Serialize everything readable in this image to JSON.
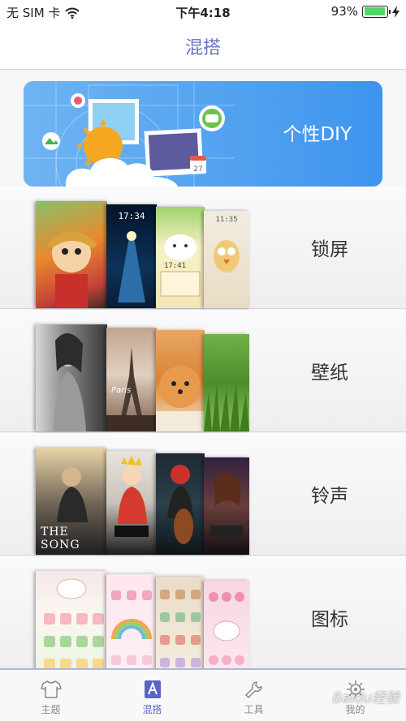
{
  "status": {
    "carrier": "无 SIM 卡",
    "time": "下午4:18",
    "battery_percent": "93%",
    "battery_level": 0.93,
    "wifi_icon": "wifi-icon",
    "charging_icon": "bolt-icon"
  },
  "nav": {
    "title": "混搭"
  },
  "banner": {
    "label": "个性DIY",
    "calendar_day": "27"
  },
  "rows": [
    {
      "label": "锁屏",
      "lock_time": "17:34",
      "lock_time2": "17:41",
      "lock_time3": "11:35"
    },
    {
      "label": "壁纸",
      "caption": "Paris"
    },
    {
      "label": "铃声",
      "caption": "THE SONG"
    },
    {
      "label": "图标"
    }
  ],
  "tabs": [
    {
      "label": "主题",
      "icon": "tshirt-icon"
    },
    {
      "label": "混搭",
      "icon": "mix-icon"
    },
    {
      "label": "工具",
      "icon": "wrench-icon"
    },
    {
      "label": "我的",
      "icon": "gear-icon"
    }
  ],
  "watermark": "Baidu经验",
  "colors": {
    "accent": "#5b63c8",
    "banner": "#4b9ff0",
    "battery": "#4cd964"
  }
}
